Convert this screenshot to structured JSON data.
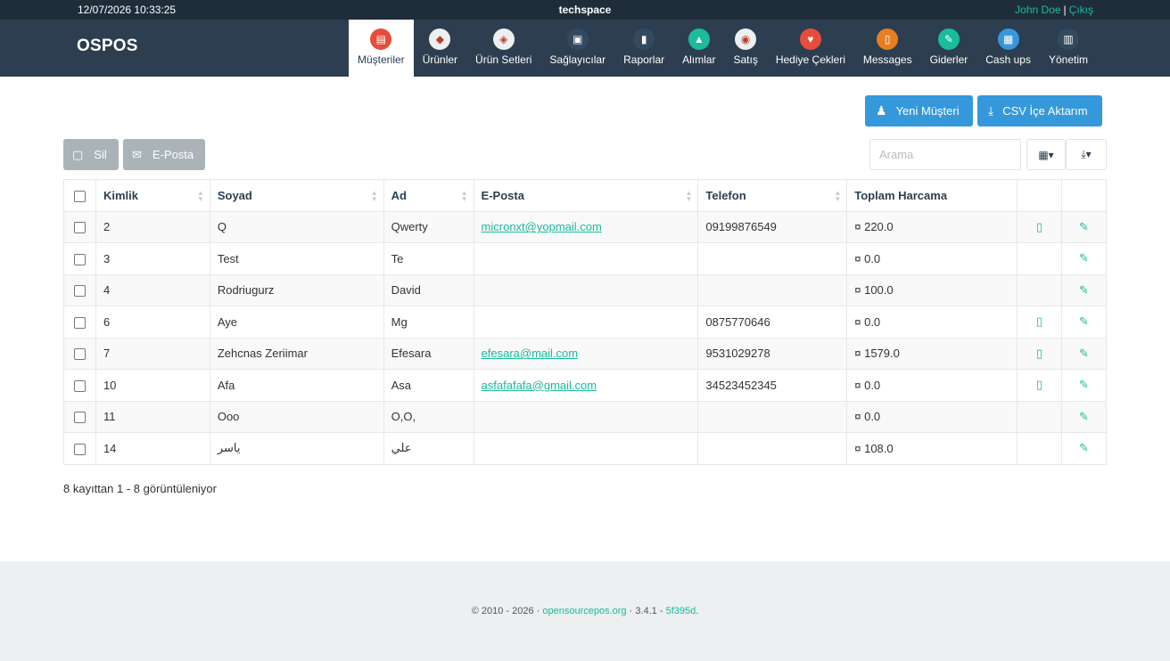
{
  "topbar": {
    "datetime": "12/07/2026 10:33:25",
    "company": "techspace",
    "user": "John Doe",
    "separator": "|",
    "logout": "Çıkış"
  },
  "navbar": {
    "logo": "OSPOS",
    "items": [
      {
        "label": "Müşteriler",
        "icon": "customers-icon",
        "color": "#e74c3c",
        "glyph": "▤",
        "active": true
      },
      {
        "label": "Ürünler",
        "icon": "items-icon",
        "color": "#ecf0f1",
        "glyph": "◆"
      },
      {
        "label": "Ürün Setleri",
        "icon": "item-kits-icon",
        "color": "#ecf0f1",
        "glyph": "◈"
      },
      {
        "label": "Sağlayıcılar",
        "icon": "suppliers-icon",
        "color": "#34495e",
        "glyph": "▣"
      },
      {
        "label": "Raporlar",
        "icon": "reports-icon",
        "color": "#34495e",
        "glyph": "▮"
      },
      {
        "label": "Alımlar",
        "icon": "receivings-icon",
        "color": "#1abc9c",
        "glyph": "▲"
      },
      {
        "label": "Satış",
        "icon": "sales-icon",
        "color": "#ecf0f1",
        "glyph": "◉"
      },
      {
        "label": "Hediye Çekleri",
        "icon": "giftcards-icon",
        "color": "#e74c3c",
        "glyph": "♥"
      },
      {
        "label": "Messages",
        "icon": "messages-icon",
        "color": "#e67e22",
        "glyph": "▯"
      },
      {
        "label": "Giderler",
        "icon": "expenses-icon",
        "color": "#1abc9c",
        "glyph": "✎"
      },
      {
        "label": "Cash ups",
        "icon": "cashups-icon",
        "color": "#3498db",
        "glyph": "▦"
      },
      {
        "label": "Yönetim",
        "icon": "config-icon",
        "color": "#34495e",
        "glyph": "▥"
      }
    ]
  },
  "toolbar": {
    "new_customer": "Yeni Müşteri",
    "csv_import": "CSV İçe Aktarım",
    "delete": "Sil",
    "email": "E-Posta",
    "search_placeholder": "Arama"
  },
  "table": {
    "headers": [
      "Kimlik",
      "Soyad",
      "Ad",
      "E-Posta",
      "Telefon",
      "Toplam Harcama"
    ],
    "rows": [
      {
        "id": "2",
        "last": "Q",
        "first": "Qwerty",
        "email": "micronxt@yopmail.com",
        "phone": "09199876549",
        "total": "¤ 220.0",
        "sms": true
      },
      {
        "id": "3",
        "last": "Test",
        "first": "Te",
        "email": "",
        "phone": "",
        "total": "¤ 0.0",
        "sms": false
      },
      {
        "id": "4",
        "last": "Rodriugurz",
        "first": "David",
        "email": "",
        "phone": "",
        "total": "¤ 100.0",
        "sms": false
      },
      {
        "id": "6",
        "last": "Aye",
        "first": "Mg",
        "email": "",
        "phone": "0875770646",
        "total": "¤ 0.0",
        "sms": true
      },
      {
        "id": "7",
        "last": "Zehcnas Zeriimar",
        "first": "Efesara",
        "email": "efesara@mail.com",
        "phone": "9531029278",
        "total": "¤ 1579.0",
        "sms": true
      },
      {
        "id": "10",
        "last": "Afa",
        "first": "Asa",
        "email": "asfafafafa@gmail.com",
        "phone": "34523452345",
        "total": "¤ 0.0",
        "sms": true
      },
      {
        "id": "11",
        "last": "Ooo",
        "first": "O,O,",
        "email": "",
        "phone": "",
        "total": "¤ 0.0",
        "sms": false
      },
      {
        "id": "14",
        "last": "ياسر",
        "first": "علي",
        "email": "",
        "phone": "",
        "total": "¤ 108.0",
        "sms": false
      }
    ]
  },
  "pagination": {
    "summary": "8 kayıttan 1 - 8 görüntüleniyor"
  },
  "footer": {
    "copyright": "© 2010 - 2026 · ",
    "site": "opensourcepos.org",
    "version": " · 3.4.1 - ",
    "commit": "5f395d",
    "end": "."
  }
}
